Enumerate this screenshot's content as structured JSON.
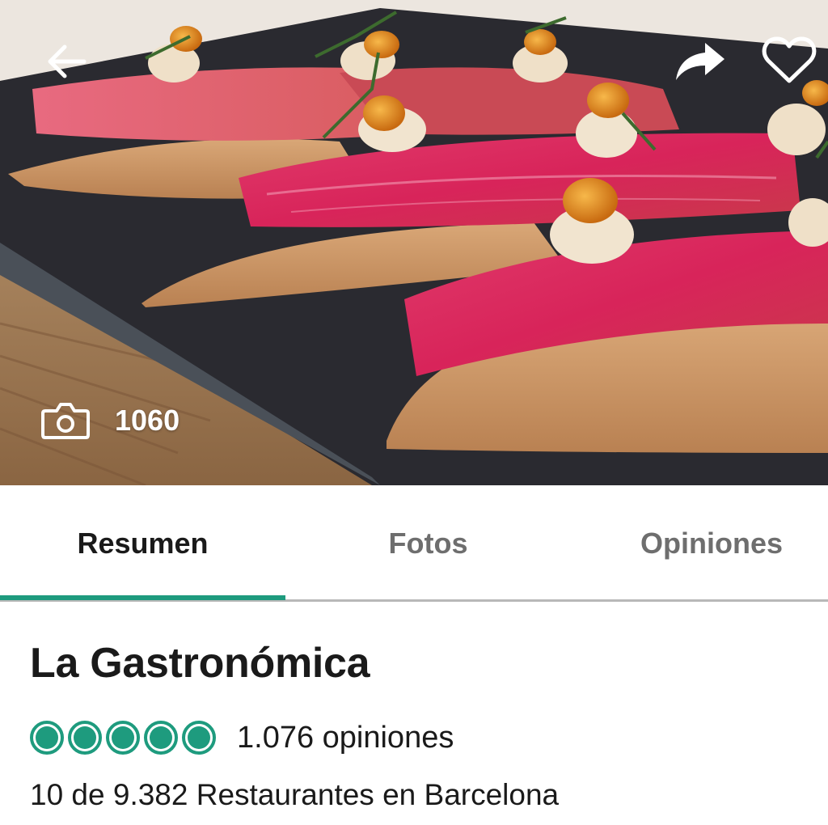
{
  "hero": {
    "photo_description_icon": "food-photo",
    "back_icon": "arrow-left-icon",
    "share_icon": "share-arrow-icon",
    "favorite_icon": "heart-outline-icon",
    "camera_icon": "camera-icon",
    "photo_count": "1060"
  },
  "tabs": {
    "items": [
      {
        "label": "Resumen",
        "active": true
      },
      {
        "label": "Fotos",
        "active": false
      },
      {
        "label": "Opiniones",
        "active": false
      }
    ],
    "accent_color": "#1e9b7e"
  },
  "restaurant": {
    "name": "La Gastronómica",
    "rating": 5,
    "rating_max": 5,
    "reviews_label": "1.076 opiniones",
    "ranking_label": "10 de 9.382 Restaurantes en Barcelona"
  },
  "colors": {
    "rating_bubble": "#1e9b7e",
    "text_primary": "#1a1a1a",
    "tab_inactive": "#6e6e6e"
  }
}
